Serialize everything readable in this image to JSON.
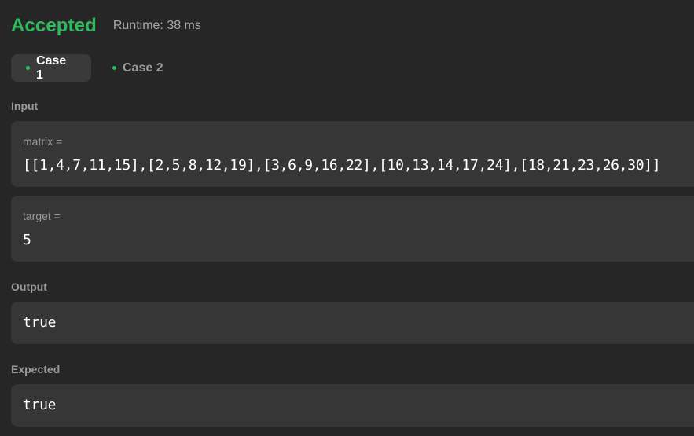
{
  "result": {
    "status": "Accepted",
    "runtime": "Runtime: 38 ms",
    "status_color": "#2cbb5d"
  },
  "tabs": [
    {
      "label": "Case 1",
      "active": true,
      "dot_color": "#2cbb5d"
    },
    {
      "label": "Case 2",
      "active": false,
      "dot_color": "#2cbb5d"
    }
  ],
  "input": {
    "label": "Input",
    "params": [
      {
        "name": "matrix =",
        "value": "[[1,4,7,11,15],[2,5,8,12,19],[3,6,9,16,22],[10,13,14,17,24],[18,21,23,26,30]]"
      },
      {
        "name": "target =",
        "value": "5"
      }
    ]
  },
  "output": {
    "label": "Output",
    "value": "true"
  },
  "expected": {
    "label": "Expected",
    "value": "true"
  }
}
